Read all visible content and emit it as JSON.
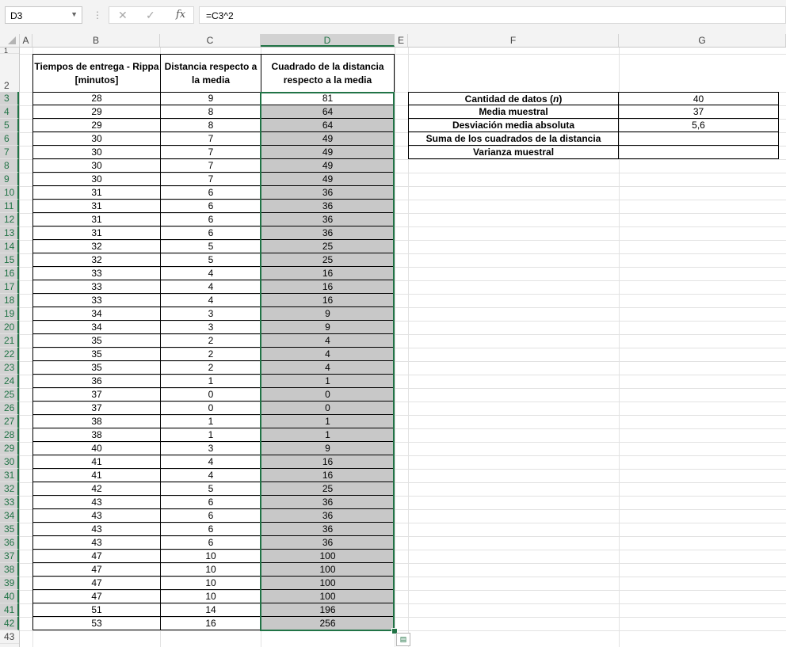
{
  "name_box": "D3",
  "formula": "=C3^2",
  "columns": [
    "A",
    "B",
    "C",
    "D",
    "E",
    "F",
    "G"
  ],
  "active_column": "D",
  "row_numbers": [
    "1",
    "2",
    "3",
    "4",
    "5",
    "6",
    "7",
    "8",
    "9",
    "10",
    "11",
    "12",
    "13",
    "14",
    "15",
    "16",
    "17",
    "18",
    "19",
    "20",
    "21",
    "22",
    "23",
    "24",
    "25",
    "26",
    "27",
    "28",
    "29",
    "30",
    "31",
    "32",
    "33",
    "34",
    "35",
    "36",
    "37",
    "38",
    "39",
    "40",
    "41",
    "42",
    "43"
  ],
  "table_headers": [
    "Tiempos de entrega - Rippa [minutos]",
    "Distancia respecto a la media",
    "Cuadrado de la distancia respecto a la media"
  ],
  "table_rows": [
    [
      "28",
      "9",
      "81"
    ],
    [
      "29",
      "8",
      "64"
    ],
    [
      "29",
      "8",
      "64"
    ],
    [
      "30",
      "7",
      "49"
    ],
    [
      "30",
      "7",
      "49"
    ],
    [
      "30",
      "7",
      "49"
    ],
    [
      "30",
      "7",
      "49"
    ],
    [
      "31",
      "6",
      "36"
    ],
    [
      "31",
      "6",
      "36"
    ],
    [
      "31",
      "6",
      "36"
    ],
    [
      "31",
      "6",
      "36"
    ],
    [
      "32",
      "5",
      "25"
    ],
    [
      "32",
      "5",
      "25"
    ],
    [
      "33",
      "4",
      "16"
    ],
    [
      "33",
      "4",
      "16"
    ],
    [
      "33",
      "4",
      "16"
    ],
    [
      "34",
      "3",
      "9"
    ],
    [
      "34",
      "3",
      "9"
    ],
    [
      "35",
      "2",
      "4"
    ],
    [
      "35",
      "2",
      "4"
    ],
    [
      "35",
      "2",
      "4"
    ],
    [
      "36",
      "1",
      "1"
    ],
    [
      "37",
      "0",
      "0"
    ],
    [
      "37",
      "0",
      "0"
    ],
    [
      "38",
      "1",
      "1"
    ],
    [
      "38",
      "1",
      "1"
    ],
    [
      "40",
      "3",
      "9"
    ],
    [
      "41",
      "4",
      "16"
    ],
    [
      "41",
      "4",
      "16"
    ],
    [
      "42",
      "5",
      "25"
    ],
    [
      "43",
      "6",
      "36"
    ],
    [
      "43",
      "6",
      "36"
    ],
    [
      "43",
      "6",
      "36"
    ],
    [
      "43",
      "6",
      "36"
    ],
    [
      "47",
      "10",
      "100"
    ],
    [
      "47",
      "10",
      "100"
    ],
    [
      "47",
      "10",
      "100"
    ],
    [
      "47",
      "10",
      "100"
    ],
    [
      "51",
      "14",
      "196"
    ],
    [
      "53",
      "16",
      "256"
    ]
  ],
  "summary": [
    {
      "label": "Cantidad de datos (n)",
      "value": "40"
    },
    {
      "label": "Media muestral",
      "value": "37"
    },
    {
      "label": "Desviación media absoluta",
      "value": "5,6"
    },
    {
      "label": "Suma de los cuadrados de la distancia",
      "value": ""
    },
    {
      "label": "Varianza muestral",
      "value": ""
    }
  ],
  "colors": {
    "accent": "#217346",
    "fill": "#c8c8c8"
  },
  "icons": [
    "cancel-icon",
    "enter-icon",
    "function-icon",
    "quick-analysis-icon"
  ]
}
